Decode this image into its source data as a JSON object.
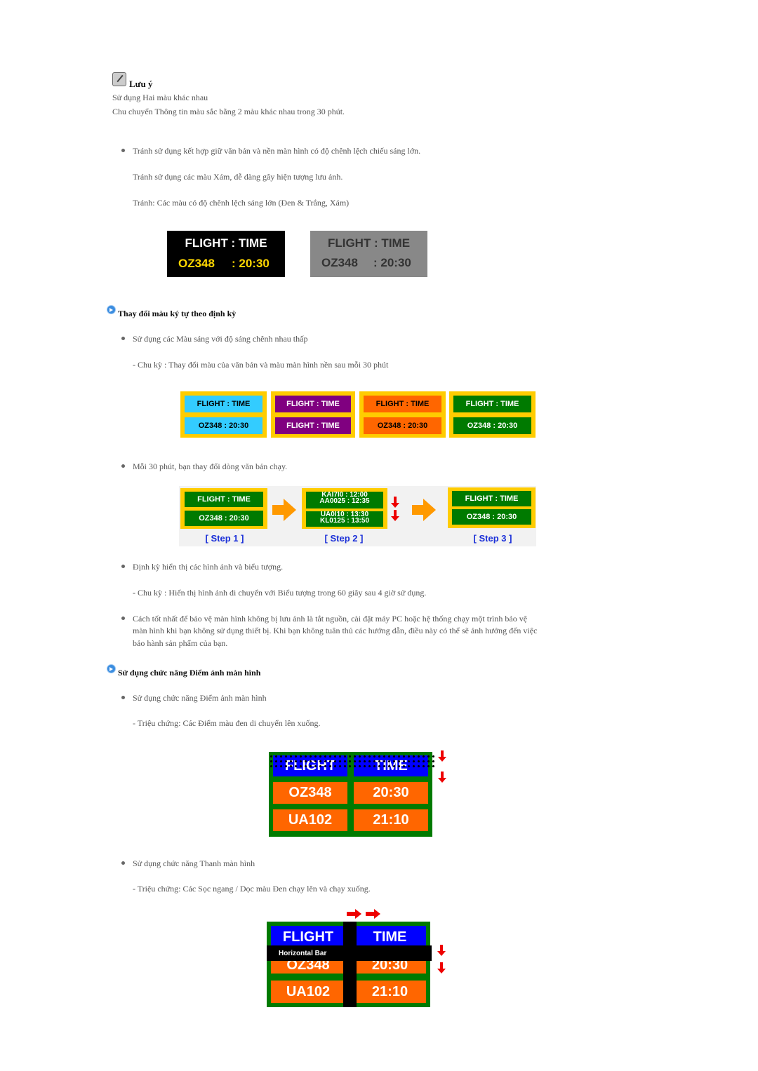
{
  "note": {
    "icon": "note-pencil-icon",
    "title": "Lưu ý",
    "line1": "Sử dụng Hai màu khác nhau",
    "line2": "Chu chuyển Thông tin màu sắc bằng 2 màu khác nhau trong 30 phút."
  },
  "section1": {
    "bullet": "Tránh sử dụng kết hợp giữ văn bản và nền màn hình có độ chênh lệch chiếu sáng lớn.",
    "line2": "Tránh sử dụng các màu Xám, dễ dàng gây hiện tượng lưu ảnh.",
    "line3": "Tránh: Các màu có độ chênh lệch sáng lớn (Đen & Trắng, Xám)"
  },
  "sample": {
    "r1": "FLIGHT  :  TIME",
    "r2a": "OZ348",
    "r2b": ":  20:30"
  },
  "heading1": "Thay đổi màu ký tự theo định kỳ",
  "section2": {
    "bullet": "Sử dụng các Màu sáng với độ sáng chênh nhau thấp",
    "line2": "- Chu kỳ : Thay đổi màu của văn bản và màu màn hình nền sau mỗi 30 phút"
  },
  "color_signs": [
    {
      "top": "FLIGHT  :  TIME",
      "bottom": "OZ348    :  20:30",
      "bg": "#33ccff",
      "fg": "#000000"
    },
    {
      "top": "FLIGHT  :  TIME",
      "bottom": "FLIGHT  :  TIME",
      "bg": "#800080",
      "fg": "#ffffff"
    },
    {
      "top": "FLIGHT  :  TIME",
      "bottom": "OZ348    :  20:30",
      "bg": "#ff6600",
      "fg": "#000000"
    },
    {
      "top": "FLIGHT  :  TIME",
      "bottom": "OZ348    :  20:30",
      "bg": "#007a00",
      "fg": "#ffffff"
    }
  ],
  "section3": {
    "bullet": "Mỗi 30 phút, bạn thay đổi dòng văn bản chạy."
  },
  "steps": {
    "step1": "[  Step 1  ]",
    "step2": "[  Step 2  ]",
    "step3": "[  Step 3  ]",
    "s1top": "FLIGHT  :  TIME",
    "s1bot": "OZ348    :  20:30",
    "s2a": "KAI7I0  :  12:00",
    "s2b": "AA0025  :  12:35",
    "s2c": "UA0I10  :  13:30",
    "s2d": "KL0125  :  13:50"
  },
  "section4": {
    "bullet": "Định kỳ hiển thị các hình ảnh và biểu tượng.",
    "line2": "- Chu kỳ : Hiển thị hình ảnh di chuyển với Biểu tượng trong 60 giây sau 4 giờ sử dụng."
  },
  "section5": {
    "line1": "Cách tốt nhất để bảo vệ màn hình không bị lưu ảnh là tắt nguồn, cài đặt máy PC hoặc hệ thống chạy một trình bảo vệ",
    "line2": "màn hình khi bạn không sử dụng thiết bị. Khi bạn không tuân thủ các hướng dẫn, điều này có thể sẽ ảnh hưởng đến việc",
    "line3": "bảo hành sản phẩm của bạn."
  },
  "heading2": "Sử dụng chức năng Điểm ảnh màn hình",
  "section6": {
    "bullet": "Sử dụng chức năng Điểm ảnh màn hình",
    "line2": "- Triệu chứng: Các Điểm màu đen di chuyển lên xuống."
  },
  "board": {
    "h1": "FLIGHT",
    "h2": "TIME",
    "r1a": "OZ348",
    "r1b": "20:30",
    "r2a": "UA102",
    "r2b": "21:10"
  },
  "section7": {
    "bullet": "Sử dụng chức năng Thanh màn hình",
    "line2": "- Triệu chứng: Các Sọc ngang / Dọc màu Đen chạy lên và chạy xuống."
  },
  "hbar_label": "Horizontal Bar"
}
